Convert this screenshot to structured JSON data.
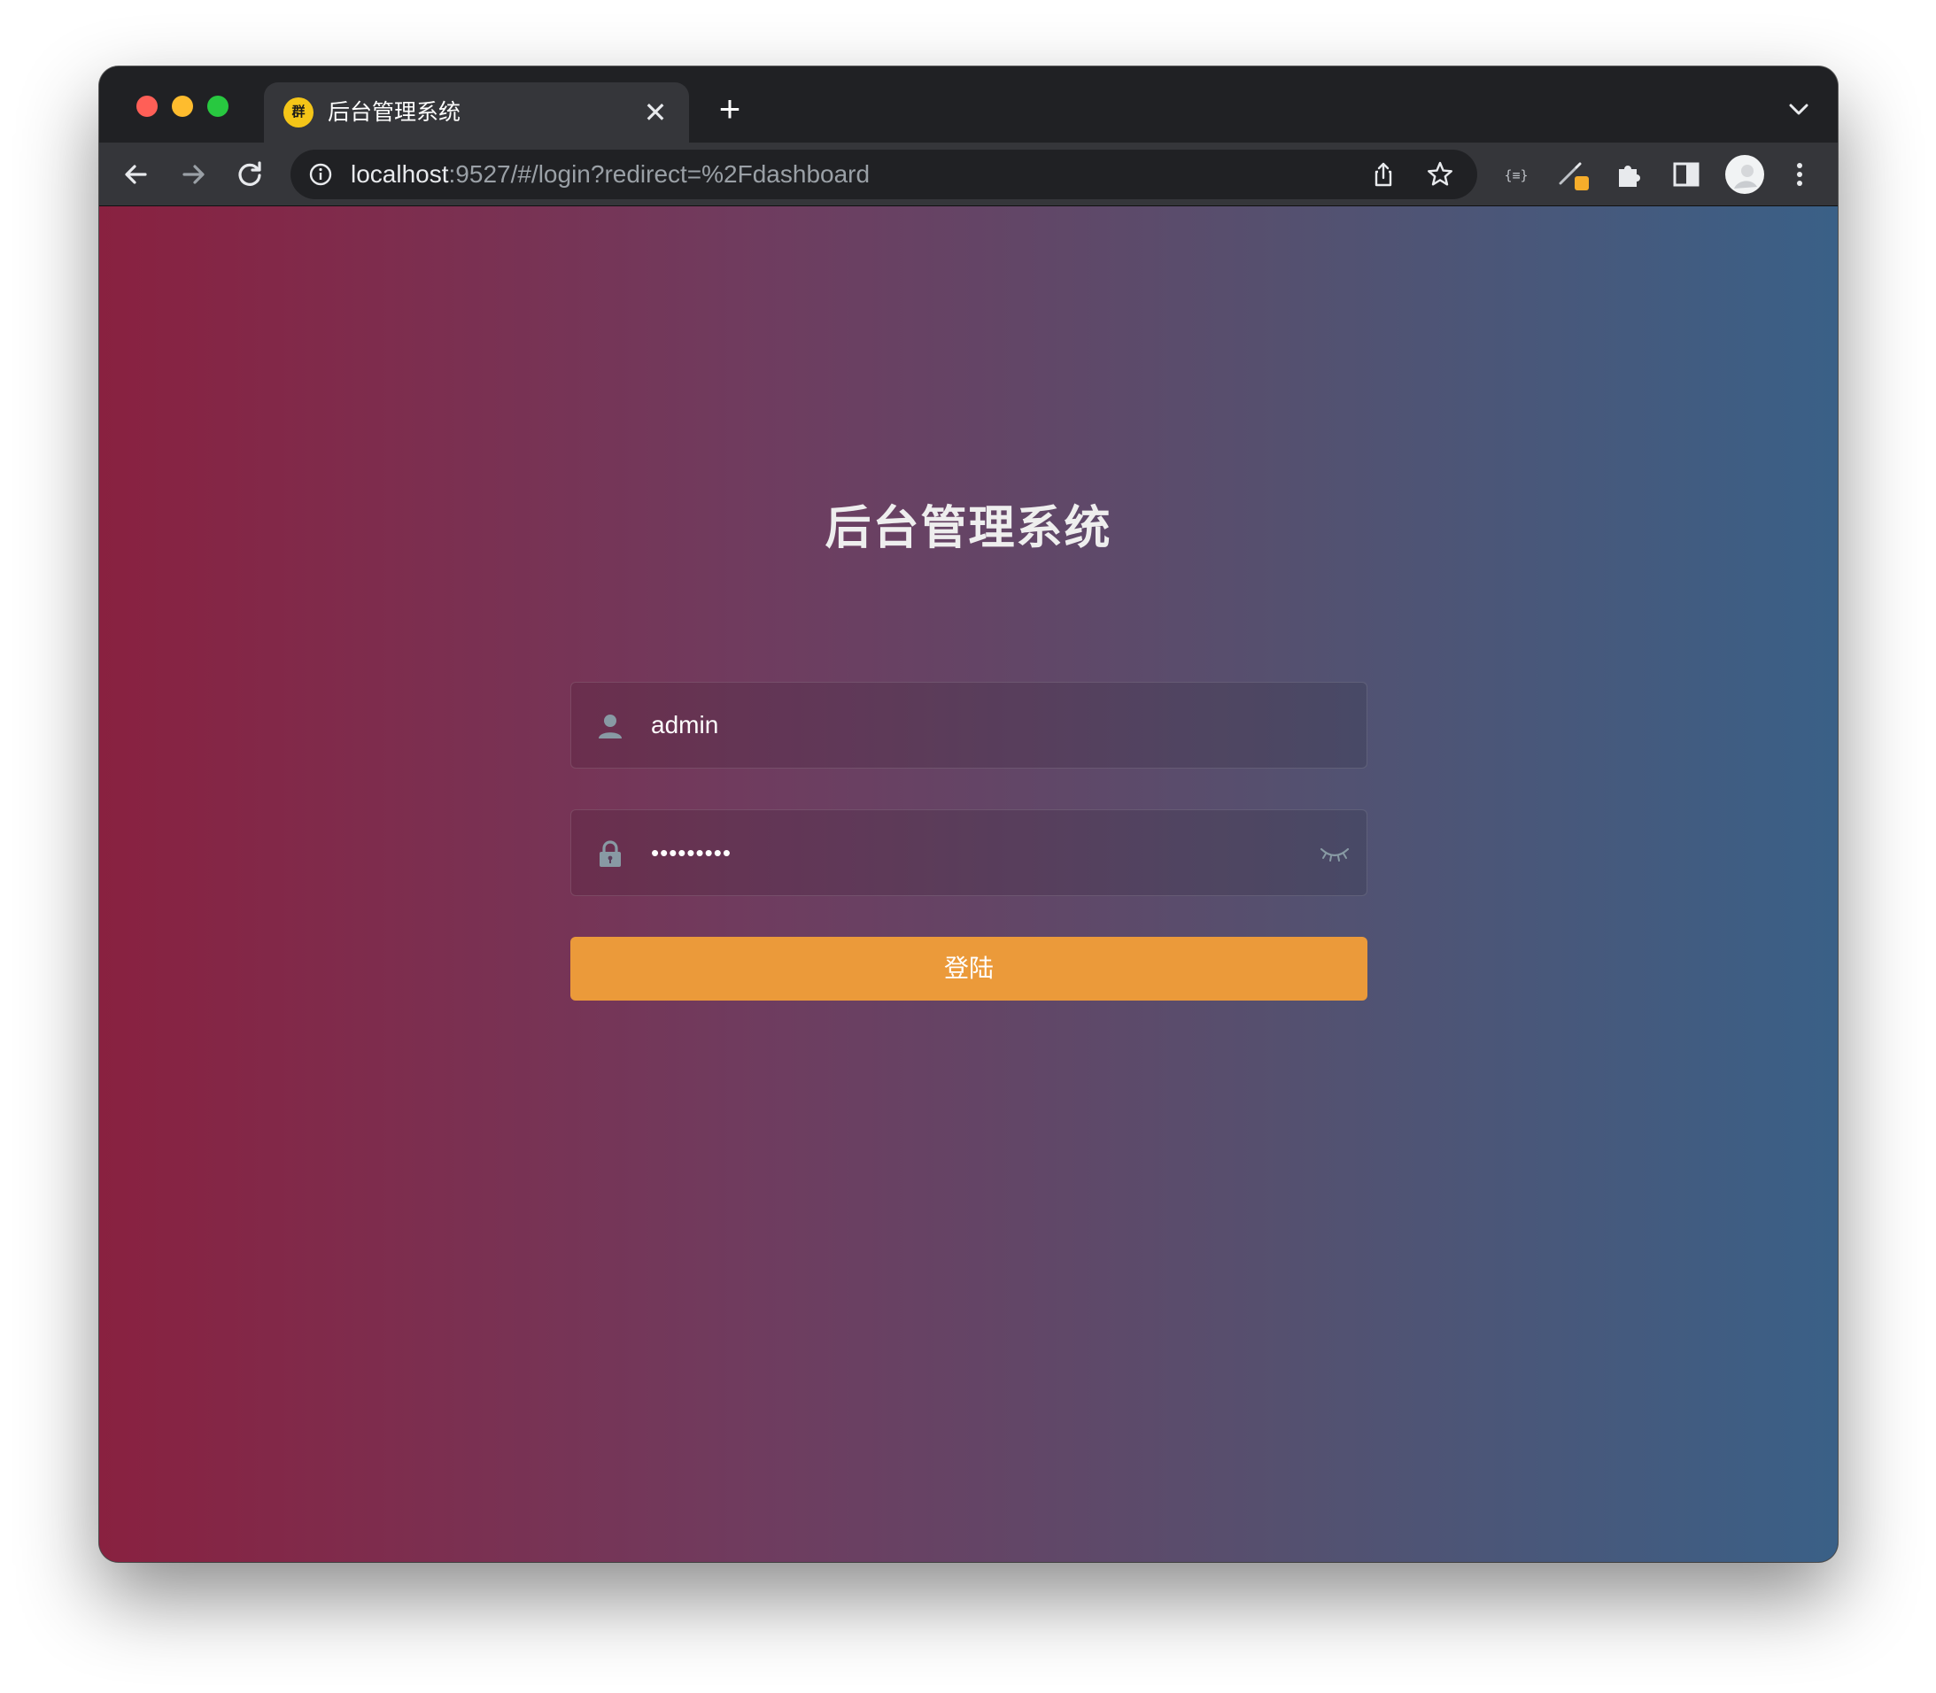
{
  "browser": {
    "tab": {
      "favicon_text": "群",
      "title": "后台管理系统",
      "close_glyph": "✕"
    },
    "new_tab_glyph": "+",
    "url": {
      "host": "localhost",
      "rest": ":9527/#/login?redirect=%2Fdashboard"
    },
    "icons": [
      "back-arrow-icon",
      "forward-arrow-icon",
      "reload-icon",
      "info-icon",
      "share-icon",
      "star-icon",
      "json-formatter-icon",
      "pen-extension-icon",
      "extensions-puzzle-icon",
      "side-panel-icon",
      "profile-avatar-icon",
      "more-menu-icon",
      "tab-list-chevron-icon"
    ]
  },
  "login": {
    "title": "后台管理系统",
    "username": {
      "value": "admin",
      "icon": "user-icon"
    },
    "password": {
      "masked": "•••••••••",
      "icon": "lock-icon",
      "toggle_icon": "eye-closed-icon"
    },
    "submit_label": "登陆"
  },
  "colors": {
    "gradient_left": "#892140",
    "gradient_right": "#3a6087",
    "button": "#eb9a3a",
    "title_text": "#eeeeee"
  }
}
